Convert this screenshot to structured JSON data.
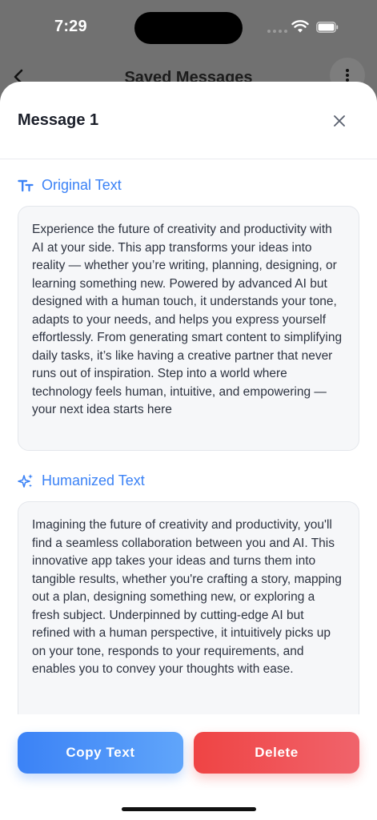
{
  "status_bar": {
    "time": "7:29"
  },
  "background_screen": {
    "title": "Saved Messages"
  },
  "modal": {
    "title": "Message 1",
    "original": {
      "label": "Original Text",
      "text": "Experience the future of creativity and productivity with AI at your side. This app transforms your ideas into reality — whether you’re writing, planning, designing, or learning something new. Powered by advanced AI but designed with a human touch, it understands your tone, adapts to your needs, and helps you express yourself effortlessly. From generating smart content to simplifying daily tasks, it’s like having a creative partner that never runs out of inspiration. Step into a world where technology feels human, intuitive, and empowering — your next idea starts here"
    },
    "humanized": {
      "label": "Humanized Text",
      "text": "Imagining the future of creativity and productivity, you'll find a seamless collaboration between you and AI. This innovative app takes your ideas and turns them into tangible results, whether you're crafting a story, mapping out a plan, designing something new, or exploring a fresh subject. Underpinned by cutting-edge AI but refined with a human perspective, it intuitively picks up on your tone, responds to your requirements, and enables you to convey your thoughts with ease."
    },
    "actions": {
      "copy_label": "Copy Text",
      "delete_label": "Delete"
    }
  },
  "colors": {
    "accent_blue": "#3b82f6",
    "danger_red": "#ef4444"
  },
  "icons": [
    "back-chevron-icon",
    "more-vertical-icon",
    "close-icon",
    "text-size-icon",
    "sparkles-icon",
    "wifi-icon",
    "battery-icon"
  ]
}
